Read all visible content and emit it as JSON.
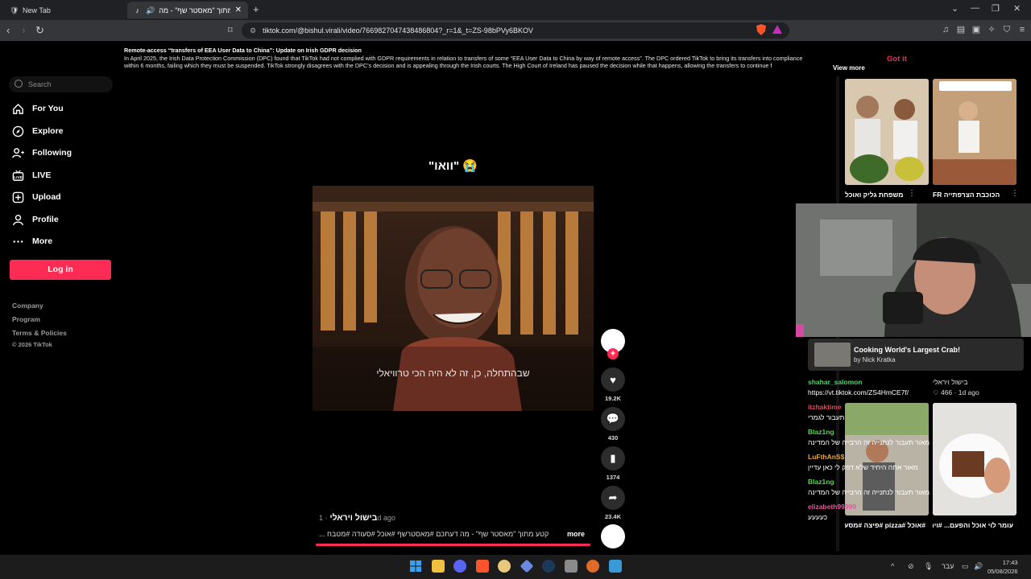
{
  "browser": {
    "tabs": [
      {
        "label": "New Tab"
      },
      {
        "label": "קטע מתוך \"מאסטר שף\" - מה"
      }
    ],
    "url": "tiktok.com/@bishul.virali/video/7669827047438486804?_r=1&_t=ZS-98bPVy6BKOV"
  },
  "notice": {
    "title": "Remote-access “transfers of EEA User Data to China”: Update on Irish GDPR decision",
    "body1": "In April 2025, the Irish Data Protection Commission (DPC) found that TikTok had not complied with GDPR requirements in relation to transfers of some “EEA User Data to China by way of remote access”. The DPC ordered TikTok to bring its transfers into compliance",
    "body2": "within 6 months, failing which they must be suspended. TikTok strongly disagrees with the DPC’s decision and is appealing through the Irish courts. The High Court of Ireland has paused the decision while that happens, allowing the transfers to continue f",
    "view_more": "View more",
    "got_it": "Got it"
  },
  "sidebar": {
    "search_placeholder": "Search",
    "items": [
      {
        "label": "For You"
      },
      {
        "label": "Explore"
      },
      {
        "label": "Following"
      },
      {
        "label": "LIVE"
      },
      {
        "label": "Upload"
      },
      {
        "label": "Profile"
      },
      {
        "label": "More"
      }
    ],
    "login": "Log in",
    "footer": [
      "Company",
      "Program",
      "Terms & Policies"
    ],
    "copyright": "© 2026 TikTok"
  },
  "video": {
    "caption": "\"וואו\" 😭",
    "subtitle": "שבהתחלה, כן, זה לא היה הכי טרוויאלי",
    "author": "בישול ויראלי",
    "date": "· 1d ago",
    "description": "קטע מתוך \"מאסטר שף\" - מה דעתכם #מאסטרשף #אוכל #סעודה #מטבח ...",
    "more": "more",
    "likes": "19.2K",
    "comments": "430",
    "saves": "1374",
    "shares": "23.4K"
  },
  "related": [
    {
      "title": "משפחת גליק ואוכל"
    },
    {
      "title": "הכוכבת הצרפתייה FR"
    },
    {
      "title": "#אוכל #pizza #פיצה #מסעדה #פורו"
    },
    {
      "title": "עומר לוי אוכל והפעם... #ויראלי #אוכל"
    }
  ],
  "overlay": {
    "now_playing_title": "Cooking World's Largest Crab!",
    "now_playing_artist": "by Nick Kratka",
    "related_meta": "בישול ויראלי",
    "related_likes": "♡ 466 · 1d ago",
    "chat": [
      {
        "user": "shahar_salomon",
        "msg": "https://vt.tiktok.com/ZS4HmCE7f/"
      },
      {
        "user": "itzhaktime",
        "msg": "תעבור לגמרי"
      },
      {
        "user": "Blaz1ng",
        "msg": "מאור תעבור לנתנייה זה הרבייה של המדינה"
      },
      {
        "user": "LuFthAnS$",
        "msg": "מאור אתה היחיד שלא דפק לי כאן עדיין"
      },
      {
        "user": "Blaz1ng",
        "msg": "מאור תעבור לנתנייה זה הרבייה של המדינה"
      },
      {
        "user": "elizabeth99999",
        "msg": "כעעעע"
      }
    ]
  },
  "taskbar": {
    "lang": "עבר",
    "time": "17:43",
    "date": "05/08/2026"
  },
  "colors": {
    "accent": "#fe2c55",
    "background": "#000000"
  }
}
